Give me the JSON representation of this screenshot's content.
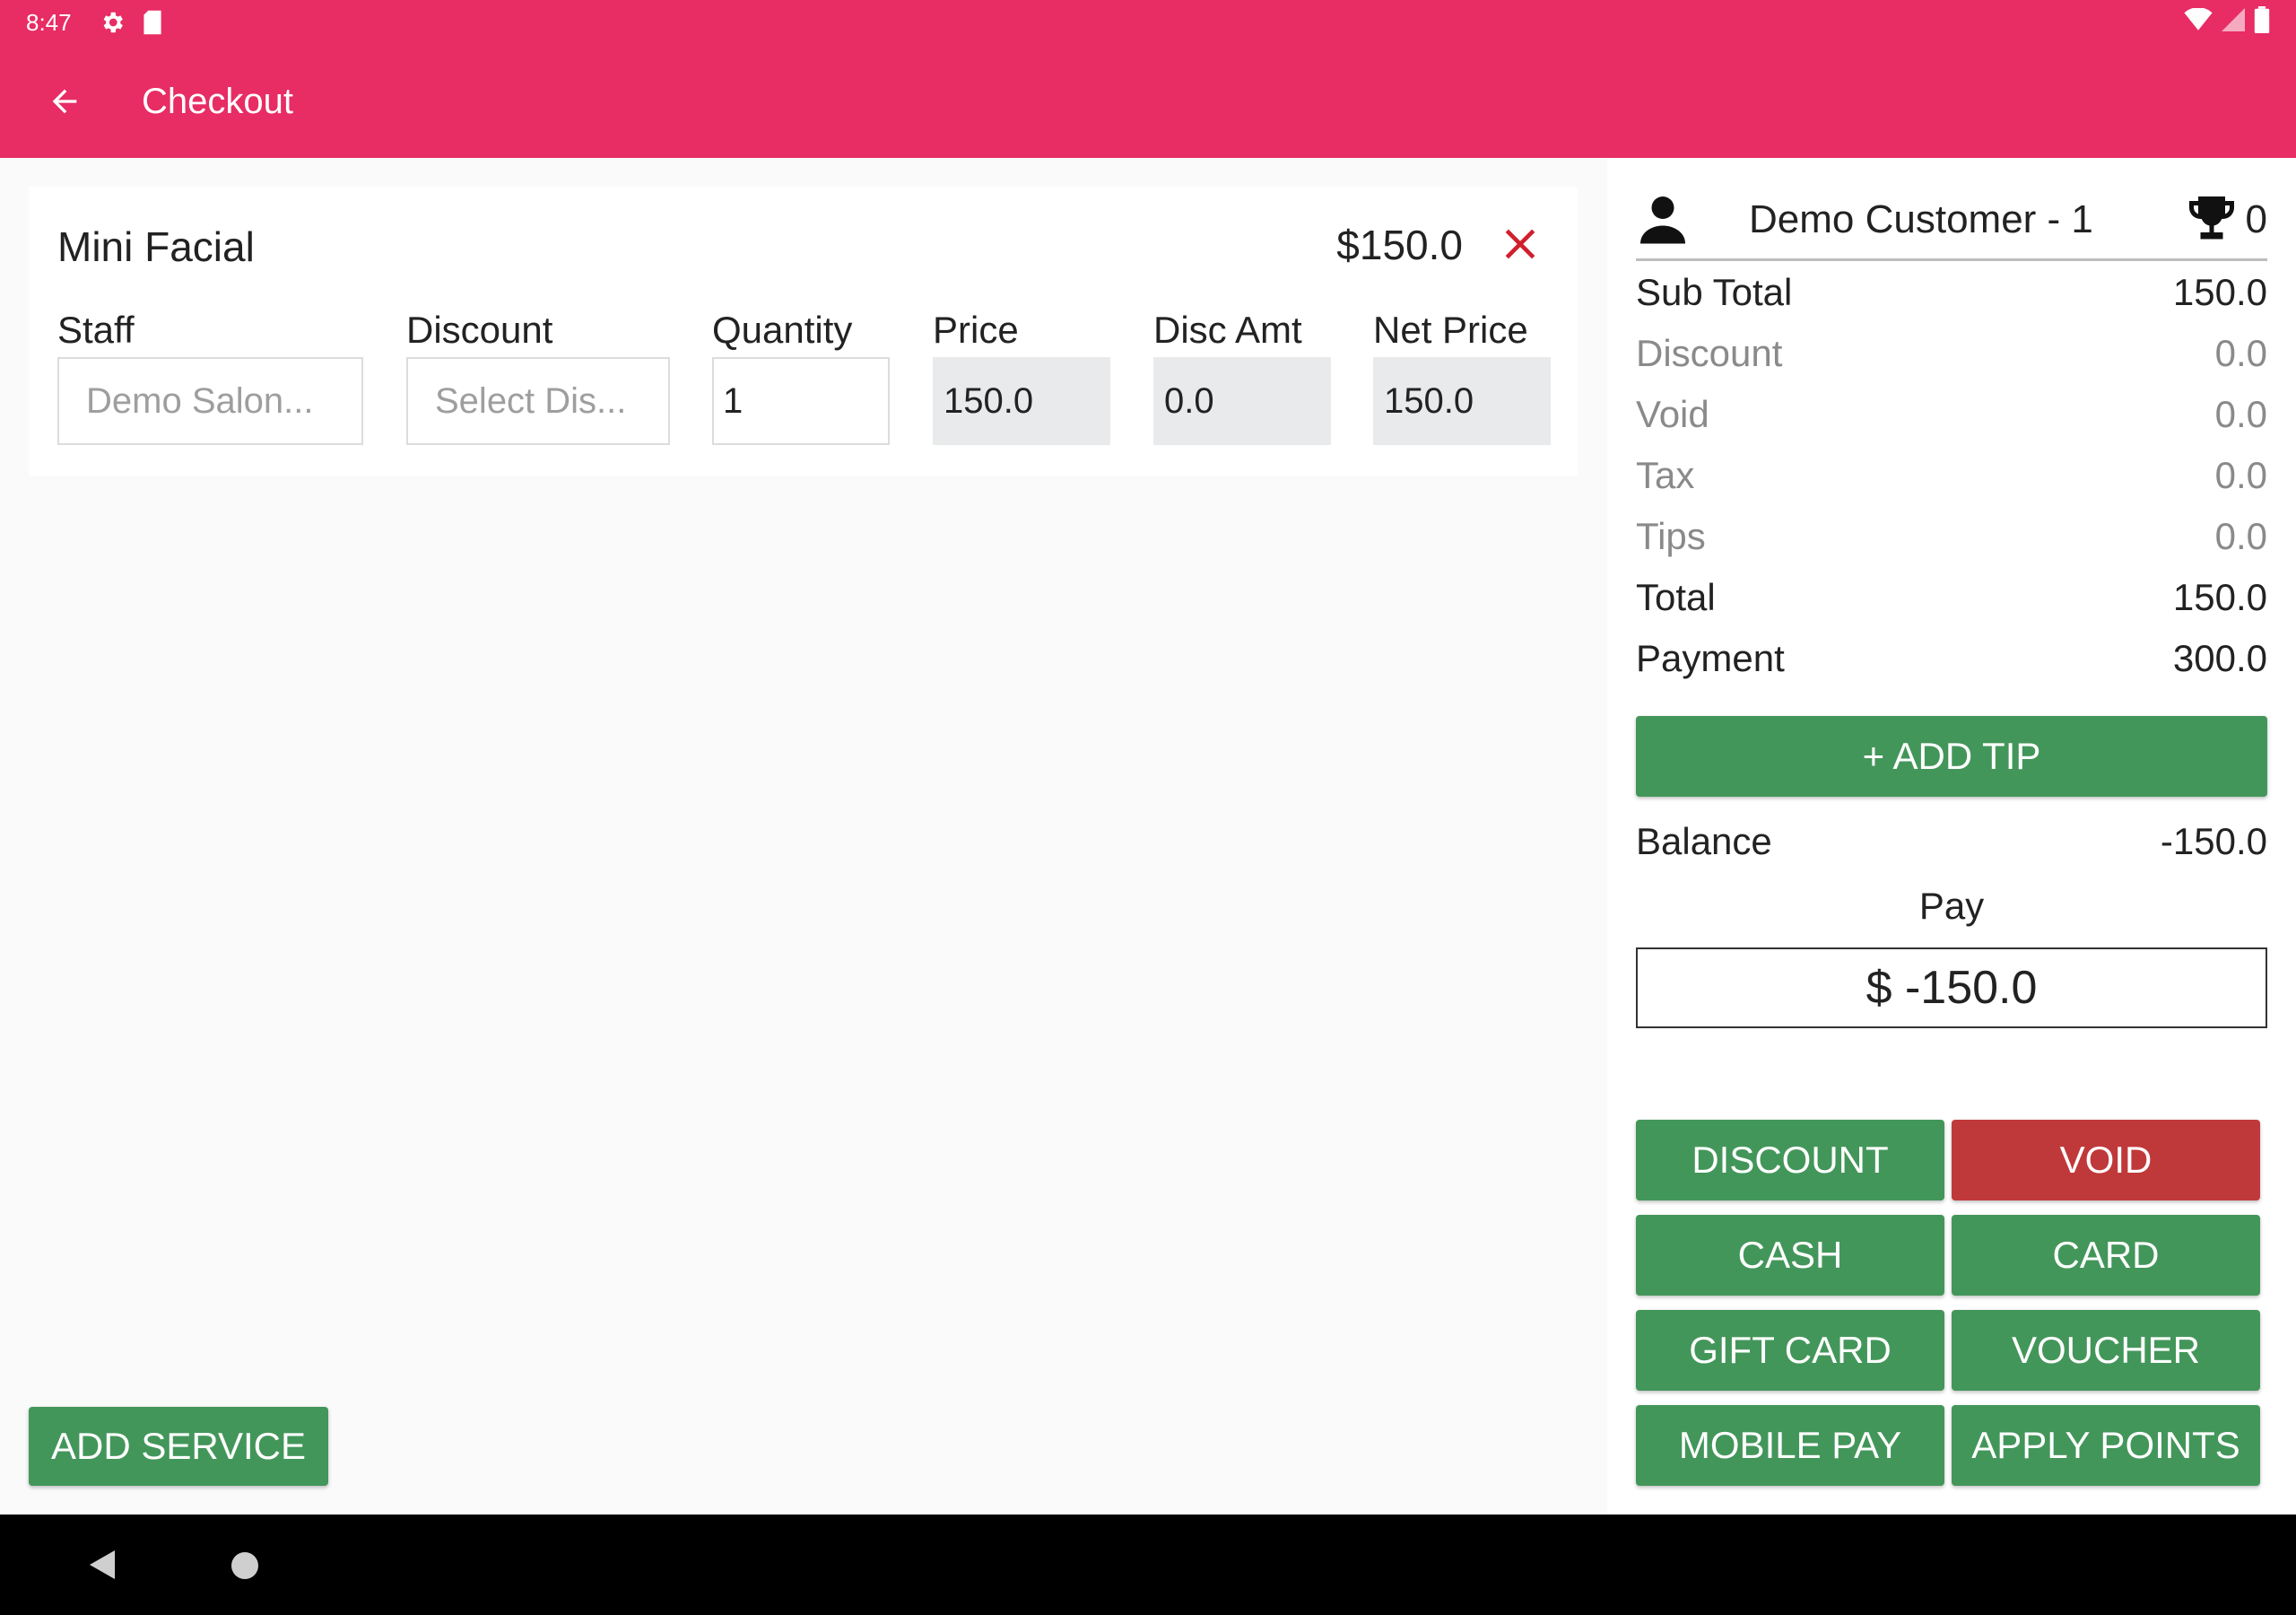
{
  "status_bar": {
    "time": "8:47"
  },
  "app_bar": {
    "title": "Checkout"
  },
  "service": {
    "name": "Mini Facial",
    "price": "$150.0",
    "labels": {
      "staff": "Staff",
      "discount": "Discount",
      "quantity": "Quantity",
      "price": "Price",
      "disc_amt": "Disc Amt",
      "net_price": "Net Price"
    },
    "staff_placeholder": "Demo Salon...",
    "discount_placeholder": "Select Dis...",
    "quantity_value": "1",
    "price_value": "150.0",
    "disc_amt_value": "0.0",
    "net_price_value": "150.0"
  },
  "add_service_label": "ADD SERVICE",
  "customer": {
    "name": "Demo  Customer - 1",
    "points": "0"
  },
  "summary": {
    "sub_total_label": "Sub Total",
    "sub_total": "150.0",
    "discount_label": "Discount",
    "discount": "0.0",
    "void_label": "Void",
    "void": "0.0",
    "tax_label": "Tax",
    "tax": "0.0",
    "tips_label": "Tips",
    "tips": "0.0",
    "total_label": "Total",
    "total": "150.0",
    "payment_label": "Payment",
    "payment": "300.0",
    "balance_label": "Balance",
    "balance": "-150.0"
  },
  "add_tip_label": "+ ADD TIP",
  "pay": {
    "label": "Pay",
    "value": "$ -150.0"
  },
  "actions": {
    "discount": "DISCOUNT",
    "void": "VOID",
    "cash": "CASH",
    "card": "CARD",
    "gift_card": "GIFT CARD",
    "voucher": "VOUCHER",
    "mobile_pay": "MOBILE PAY",
    "apply_points": "APPLY POINTS"
  },
  "colors": {
    "app_bar": "#e82c64",
    "primary_button": "#43965a",
    "void_button": "#c0393a",
    "remove_icon": "#d0202a"
  }
}
